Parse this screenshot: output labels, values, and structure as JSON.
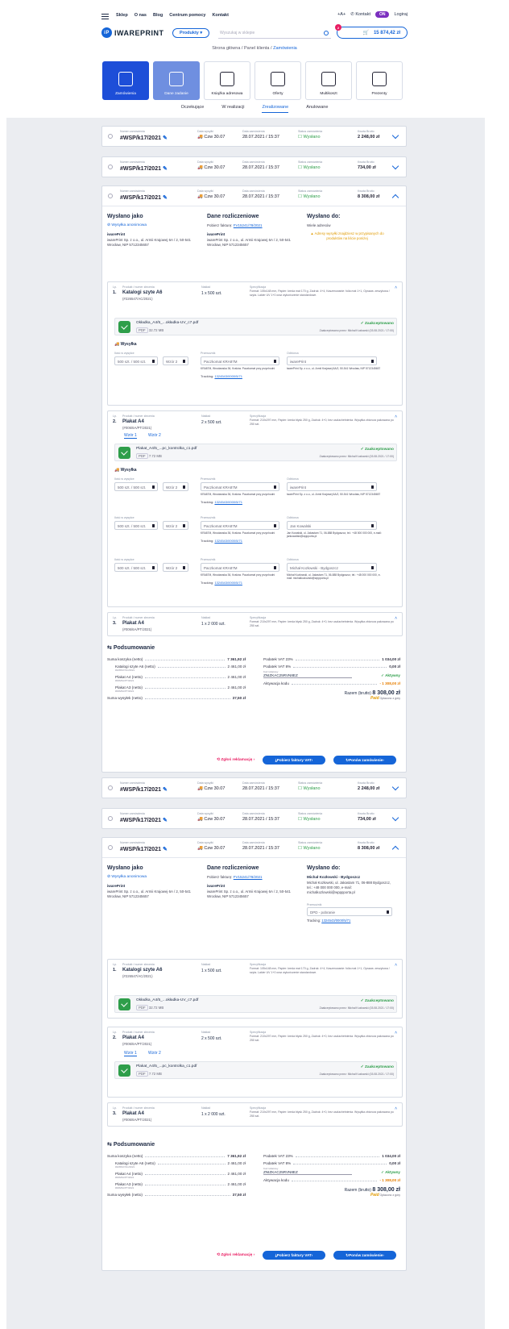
{
  "nav": {
    "links": [
      "Sklep",
      "O nas",
      "Blog",
      "Centrum pomocy",
      "Kontakt"
    ],
    "currency": "+A+",
    "contact": "Kontakt",
    "lang": "ON",
    "login": "Logiraj",
    "logo": "IWAREPRINT",
    "products": "Produkty",
    "search_placeholder": "Wyszukaj w sklepie",
    "cart_total": "15 874,42 zł",
    "cart_count": "2"
  },
  "breadcrumb": {
    "home": "Strona główna",
    "panel": "Panel klienta",
    "current": "Zamówienia"
  },
  "tiles": [
    "Zamówienia",
    "Dane zadanie",
    "Książka adresowa",
    "Oferty",
    "Multikoszt",
    "Prezenty"
  ],
  "tabs": [
    "Oczekujące",
    "W realizacji",
    "Zrealizowane",
    "Anulowane"
  ],
  "labels": {
    "order_no": "Numer zamówienia",
    "ship_date": "Data wysyłki",
    "order_date": "Data zamówienia",
    "status": "Status zamówienia",
    "gross": "Kwota Brutto"
  },
  "orders": [
    {
      "no": "#WSP/k17/2021",
      "ship": "Czw 30.07",
      "date": "28.07.2021 / 15:37",
      "status": "Wysłano",
      "amount": "2 248,00 zł"
    },
    {
      "no": "#WSP/k17/2021",
      "ship": "Czw 30.07",
      "date": "28.07.2021 / 15:37",
      "status": "Wysłano",
      "amount": "734,00 zł"
    },
    {
      "no": "#WSP/k17/2021",
      "ship": "Czw 30.07",
      "date": "28.07.2021 / 15:37",
      "status": "Wysłano",
      "amount": "8 308,00 zł"
    },
    {
      "no": "#WSP/k17/2021",
      "ship": "Czw 30.07",
      "date": "28.07.2021 / 15:37",
      "status": "Wysłano",
      "amount": "2 248,00 zł"
    },
    {
      "no": "#WSP/k17/2021",
      "ship": "Czw 30.07",
      "date": "28.07.2021 / 15:37",
      "status": "Wysłano",
      "amount": "734,00 zł"
    },
    {
      "no": "#WSP/k17/2021",
      "ship": "Czw 30.07",
      "date": "28.07.2021 / 15:37",
      "status": "Wysłano",
      "amount": "8 308,00 zł"
    }
  ],
  "detail": {
    "sent_as": "Wysłano jako",
    "anon": "Wysyłka anonimowa",
    "sender": "iwarePrint",
    "sender_addr": "iwarePrint Sp. z o.o., ul. Armii Krajowej 6A / 2, 50-541 Wrocław, NIP 5712345657",
    "billing": "Dane rozliczeniowe",
    "invoice_label": "Pobierz fakturę:",
    "invoice_no": "FV15241/78/2021",
    "sent_to": "Wysłano do:",
    "multi": "Wiele adresów",
    "multi_warn": "Adresy wysyłki znajdziesz w przypisanych do produktów na liście poniżej",
    "recipient_name": "Michał Kozłowski - Bydgoszcz",
    "recipient_addr": "Michał Kozłowski, ul. Jakastam 71, 06-888 Bydgoszcz, tel.: +48 000 000 000, e-mail: michalkozlowski@wpppporta.pl",
    "carrier_label": "Przewoźnik",
    "carrier": "DPD - pobranie",
    "tracking_label": "Tracking:",
    "tracking": "1324543/0000/5/71"
  },
  "item_labels": {
    "lp": "Lp.",
    "name": "Produkt / numer zlecenia",
    "quantity": "Nakład",
    "spec": "Specyfikacja"
  },
  "items": [
    {
      "lp": "1.",
      "name": "Katalogi szyte A6",
      "code": "(#226547/AC/2021)",
      "qty": "1 x 500 szt.",
      "spec": "Format: 105x148 mm, Papier: kreda mat 170 g, Zadruk: 4+4, Kaszerowanie: folia mat 1+1, Oprawa: zeszytowa / szyta. Lakier UV 1+0 oraz wykończenie standardowe."
    },
    {
      "lp": "2.",
      "name": "Plakat A4",
      "code": "(#006/6A/PT/2021)",
      "qty": "2 x 500 szt.",
      "spec": "Format: 210x297 mm, Papier: kreda błysk 250 g, Zadruk: 4+0, bez uszlachetnienia. Wysyłka zbiorcza pakowana po 250 szt."
    },
    {
      "lp": "3.",
      "name": "Plakat A4",
      "code": "(#006/6A/PT/2021)",
      "qty": "1 x 2 000 szt.",
      "spec": "Format: 210x297 mm, Papier: kreda błysk 250 g, Zadruk: 4+0, bez uszlachetnienia. Wysyłka zbiorcza pakowana po 250 szt."
    }
  ],
  "file": {
    "name1": "Okładka_A4/5_...okładka-UV_c7.pdf",
    "name2": "Plakat_A4/5_...pc_kontrolka_c1.pdf",
    "type": "PDF",
    "size1": "32.72 MB",
    "size2": "7.72 MB",
    "accepted": "Zaakceptowano",
    "accepted_by": "Zaakceptowano przez: Michał Kozłowski (03.08.2021 / 17:00)"
  },
  "ship": {
    "title": "Wysyłka",
    "qty_label": "Ilość w wysyłce",
    "qty1": "500 szt. / 500 szt.",
    "wave1": "Wzór 1",
    "wave2": "Wzór 2",
    "carrier_label": "Przewoźnik",
    "carrier": "Paczkomat KRA87M",
    "recipient_label": "Odbiorca",
    "r1": "iwarePrint",
    "r2": "Jan Kowalski",
    "r3": "Michał Kozłowski - Bydgoszcz",
    "locker": "KRA87M, Wrocławska 36, Kraków. Paczkomat przy przychodni",
    "addr1": "iwarePrint Sp. z o.o., ul. Armii Krajowej 6A/2, 50-541 Wrocław, NIP 5712345657",
    "addr2": "Jan Kowalski, ul. Jakastam 71, 06-888 Bydgoszcz, tel.: +48 000 000 000, e-mail: jankowalski@wppporta.pl",
    "addr3": "Michał Kozłowski, ul. Jakastam 71, 06-888 Bydgoszcz, tel.: +48 000 000 000, e-mail: michalkozlowski@wppporta.pl",
    "tracking_label": "Tracking:",
    "tracking": "1324543/0000/5/71"
  },
  "summary": {
    "title": "Podsumowanie",
    "net_cart": "Suma koszyka (netto)",
    "net_cart_v": "7 361,92 zł",
    "i1": "Katalogi szyte A6 (netto)",
    "i1c": "#226547/AC/2021",
    "i1v": "2 461,00 zł",
    "i2": "Plakat A4 (netto)",
    "i2c": "#006/6A/PT/2021",
    "i2v": "2 461,00 zł",
    "i3": "Plakat A3 (netto)",
    "i3c": "#006/6A/PT/2021",
    "i3v": "2 461,00 zł",
    "ship": "Suma wysyłek (netto)",
    "ship_v": "37,50 zł",
    "vat23": "Podatek VAT 23%",
    "vat23_v": "1 034,00 zł",
    "vat8": "Podatek VAT 8%",
    "vat8_v": "0,00 zł",
    "code_label": "Kod rabatowy",
    "code": "ZNIZKAC25RVN8EZ",
    "active": "Aktywny",
    "act": "Aktywacja kodu",
    "act_v": "- 1 308,00 zł",
    "total_label": "Razem (brutto)",
    "total": "8 308,00 zł",
    "paid": "Paid",
    "paid_info": "Opłacono z góry"
  },
  "actions": {
    "complaint": "Zgłoś reklamację",
    "invoice": "Pobierz faktury VAT",
    "repeat": "Ponów zamówienie"
  }
}
